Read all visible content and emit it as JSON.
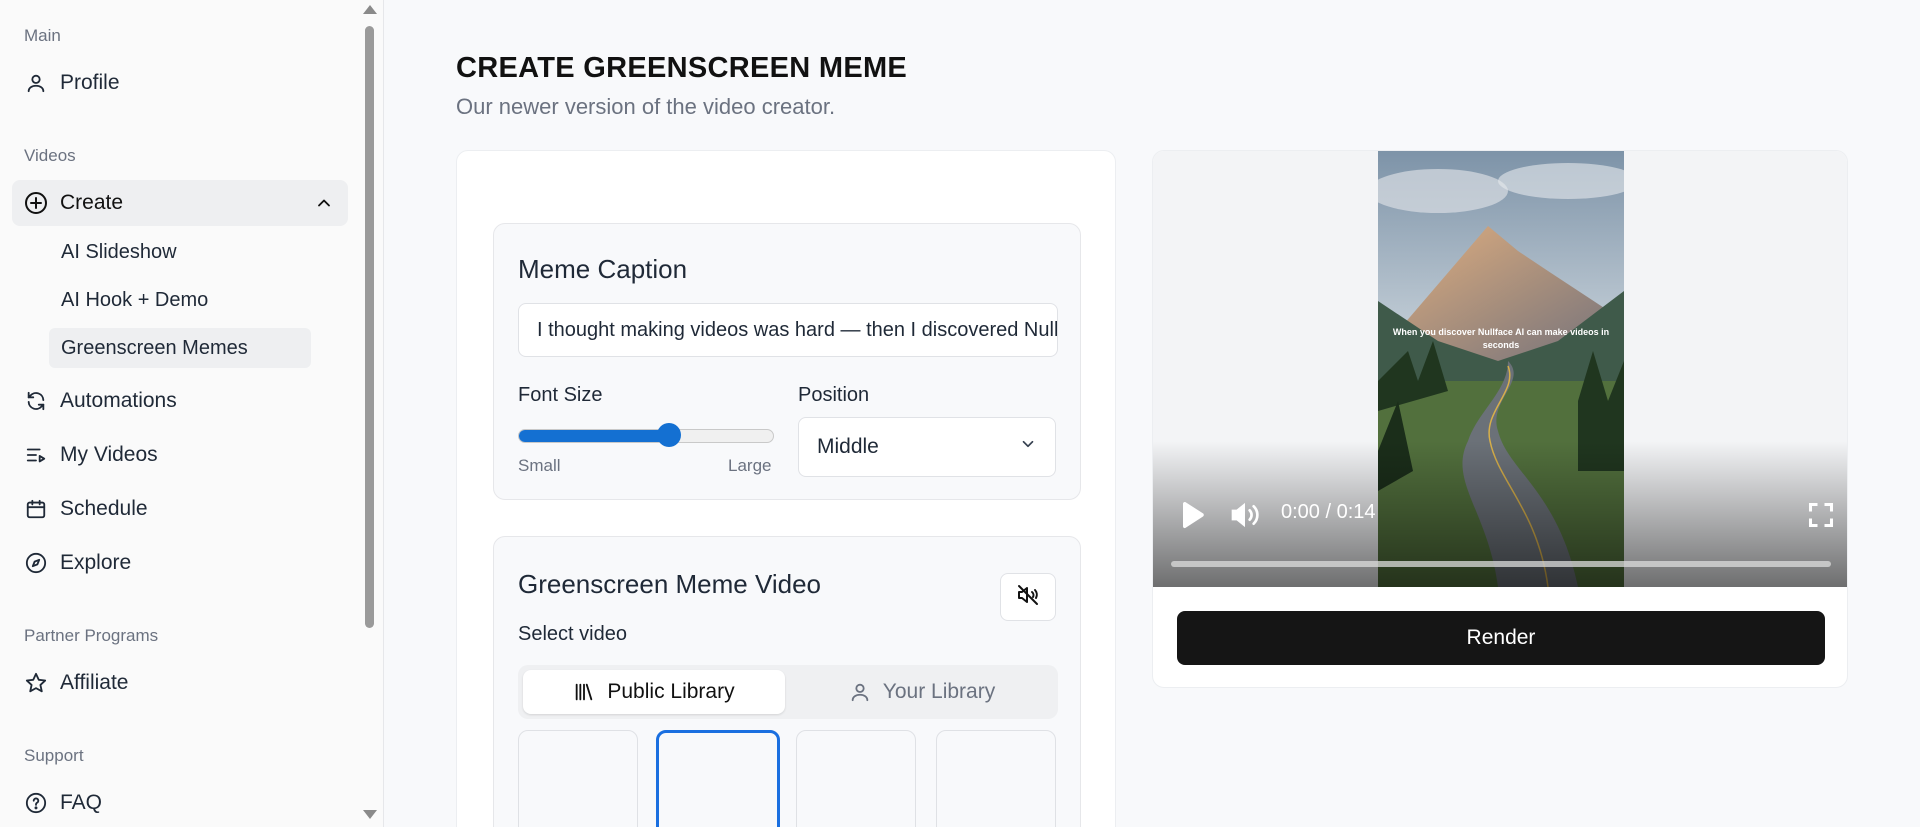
{
  "sidebar": {
    "sections": {
      "main": "Main",
      "videos": "Videos",
      "partner": "Partner Programs",
      "support": "Support"
    },
    "items": {
      "profile": "Profile",
      "create": "Create",
      "automations": "Automations",
      "my_videos": "My Videos",
      "schedule": "Schedule",
      "explore": "Explore",
      "affiliate": "Affiliate",
      "faq": "FAQ"
    },
    "create_sub": {
      "ai_slideshow": "AI Slideshow",
      "ai_hook_demo": "AI Hook + Demo",
      "greenscreen_memes": "Greenscreen Memes"
    }
  },
  "page": {
    "title": "CREATE GREENSCREEN MEME",
    "subtitle": "Our newer version of the video creator."
  },
  "caption_card": {
    "title": "Meme Caption",
    "input_value": "I thought making videos was hard — then I discovered Nullface AI",
    "font_size_label": "Font Size",
    "font_size_min": "Small",
    "font_size_max": "Large",
    "font_size_value": 0.59,
    "position_label": "Position",
    "position_value": "Middle"
  },
  "video_card": {
    "title": "Greenscreen Meme Video",
    "select_label": "Select video",
    "tab_public": "Public Library",
    "tab_yours": "Your Library",
    "selected_thumb_index": 1
  },
  "preview": {
    "overlay_text": "When you discover Nullface AI can make videos in seconds",
    "time": "0:00 / 0:14",
    "render_label": "Render"
  },
  "colors": {
    "accent": "#1470d2",
    "render_button": "#151515"
  }
}
